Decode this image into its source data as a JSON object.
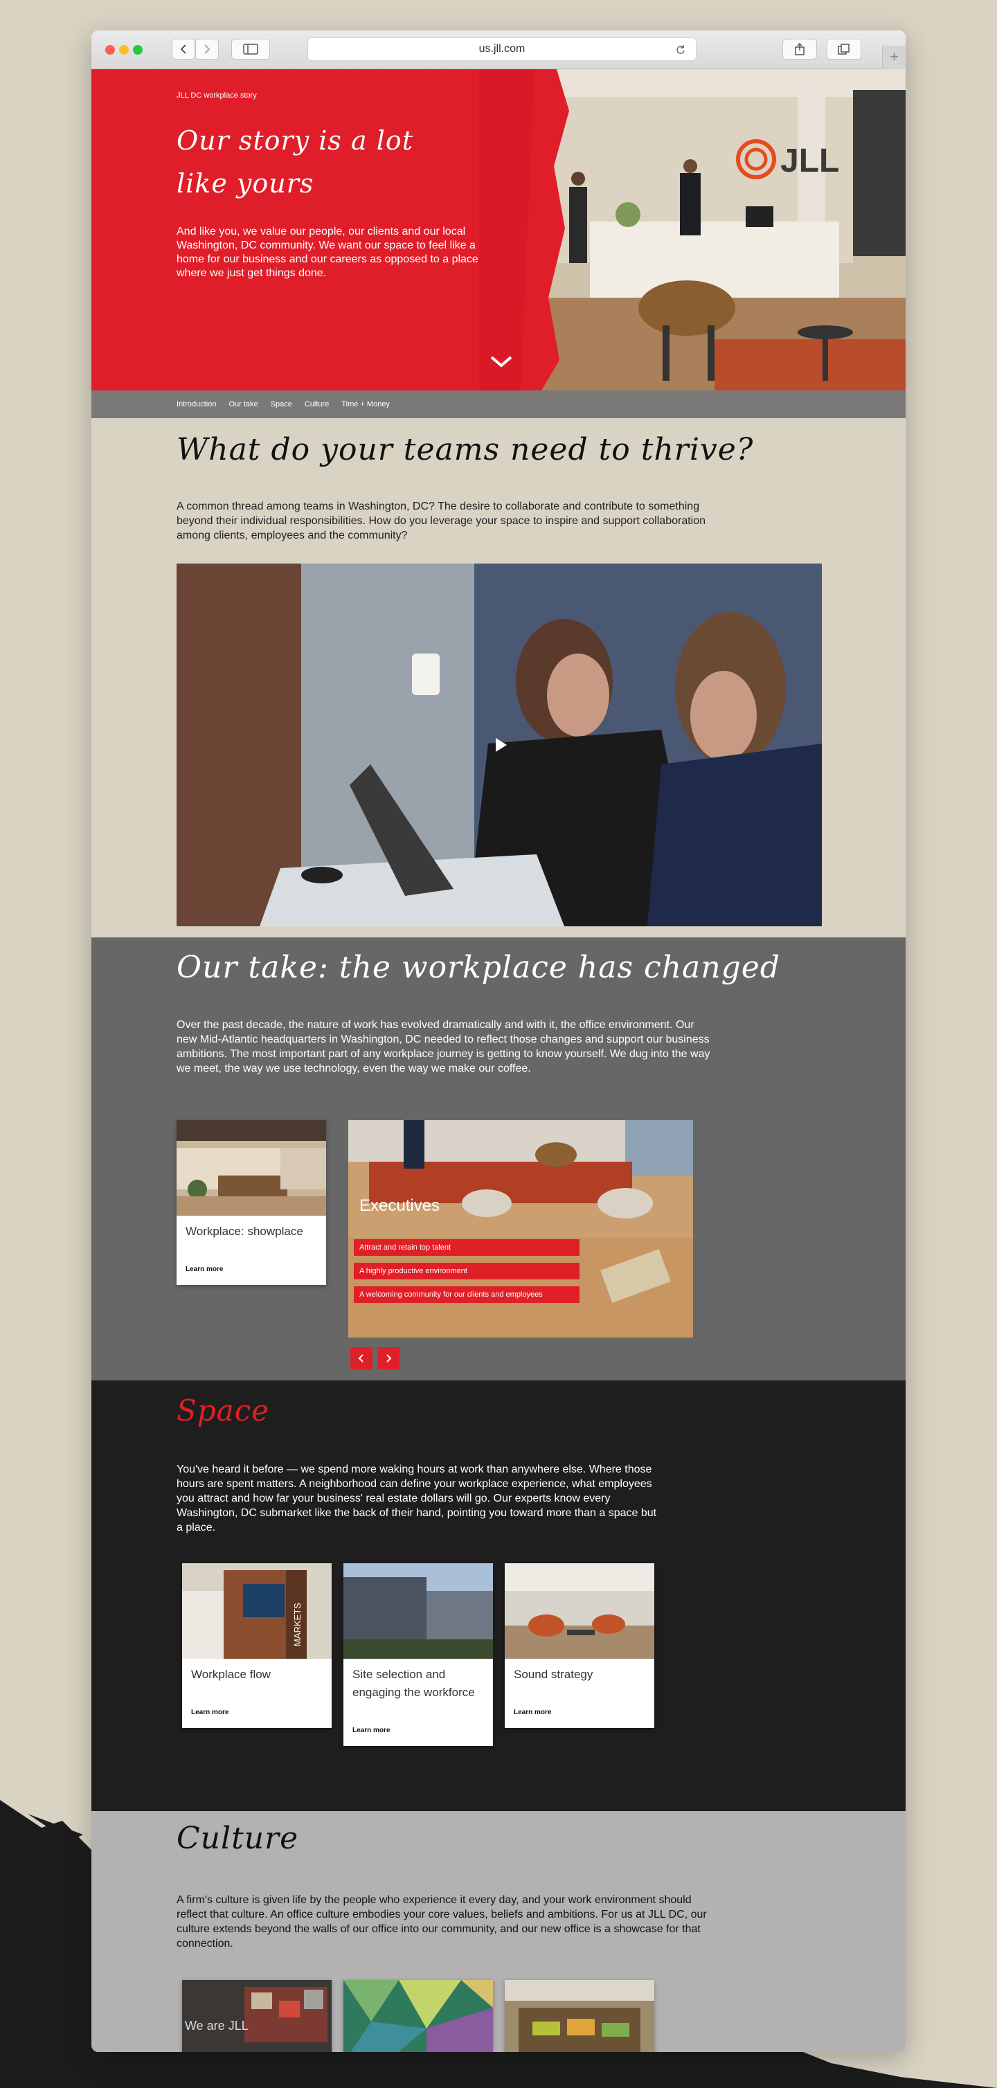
{
  "browser": {
    "url": "us.jll.com",
    "plus": "+"
  },
  "hero": {
    "eyebrow": "JLL DC workplace story",
    "title": "Our story is a lot like yours",
    "intro": "And like you, we value our people, our clients and our local Washington, DC community. We want our space to feel like a home for our business and our careers as opposed to a place where we just get things done.",
    "logo_text": "JLL"
  },
  "subnav": [
    "Introduction",
    "Our take",
    "Space",
    "Culture",
    "Time + Money"
  ],
  "thrive": {
    "title": "What do your teams need to thrive?",
    "body": "A common thread among teams in Washington, DC? The desire to collaborate and contribute to something beyond their individual responsibilities. How do you leverage your space to inspire and support collaboration among clients, employees and the community?"
  },
  "our_take": {
    "title": "Our take: the workplace has changed",
    "body": "Over the past decade, the nature of work has evolved dramatically and with it, the office environment. Our new Mid-Atlantic headquarters in Washington, DC needed to reflect those changes and support our business ambitions. The most important part of any workplace journey is getting to know yourself. We dug into the way we meet, the way we use technology, even the way we make our coffee.",
    "card": {
      "title": "Workplace: showplace",
      "link": "Learn more"
    },
    "exec": {
      "title": "Executives",
      "tags": [
        "Attract and retain top talent",
        "A highly productive environment",
        "A welcoming community for our clients and employees"
      ]
    }
  },
  "space": {
    "title": "Space",
    "body": "You've heard it before — we spend more waking hours at work than anywhere else. Where those hours are spent matters. A neighborhood can define your workplace experience, what employees you attract and how far your business' real estate dollars will go. Our experts know every Washington, DC submarket like the back of their hand, pointing you toward more than a space but a place.",
    "cards": [
      {
        "title": "Workplace flow",
        "link": "Learn more",
        "photo_text": "MARKETS"
      },
      {
        "title": "Site selection and engaging the workforce",
        "link": "Learn more"
      },
      {
        "title": "Sound strategy",
        "link": "Learn more"
      }
    ]
  },
  "culture": {
    "title": "Culture",
    "body": "A firm's culture is given life by the people who experience it every day, and your work environment should reflect that culture. An office culture embodies your core values, beliefs and ambitions. For us at JLL DC, our culture extends beyond the walls of our office into our community, and our new office is a showcase for that connection.",
    "photo_text": "We are JLL"
  }
}
